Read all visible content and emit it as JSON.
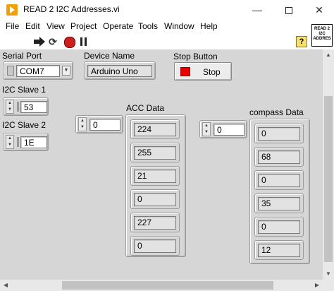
{
  "window": {
    "title": "READ 2 I2C Addresses.vi",
    "minimize": "—",
    "close": "✕"
  },
  "menu": [
    "File",
    "Edit",
    "View",
    "Project",
    "Operate",
    "Tools",
    "Window",
    "Help"
  ],
  "toolbar": {
    "help": "?",
    "vi_icon_text": [
      "READ 2",
      "I2C",
      "ADDRES"
    ]
  },
  "controls": {
    "serial_port": {
      "label": "Serial Port",
      "value": "COM7"
    },
    "device_name": {
      "label": "Device Name",
      "value": "Arduino Uno"
    },
    "stop_button": {
      "label": "Stop Button",
      "text": "Stop"
    },
    "i2c_slave_1": {
      "label": "I2C Slave 1",
      "value": "53"
    },
    "i2c_slave_2": {
      "label": "I2C Slave 2",
      "value": "1E"
    },
    "acc_data": {
      "label": "ACC Data",
      "index": "0",
      "values": [
        "224",
        "255",
        "21",
        "0",
        "227",
        "0"
      ]
    },
    "compass_data": {
      "label": "compass Data",
      "index": "0",
      "values": [
        "0",
        "68",
        "0",
        "35",
        "0",
        "12"
      ]
    }
  },
  "scroll": {
    "up": "▲",
    "down": "▼",
    "left": "◀",
    "right": "▶"
  }
}
